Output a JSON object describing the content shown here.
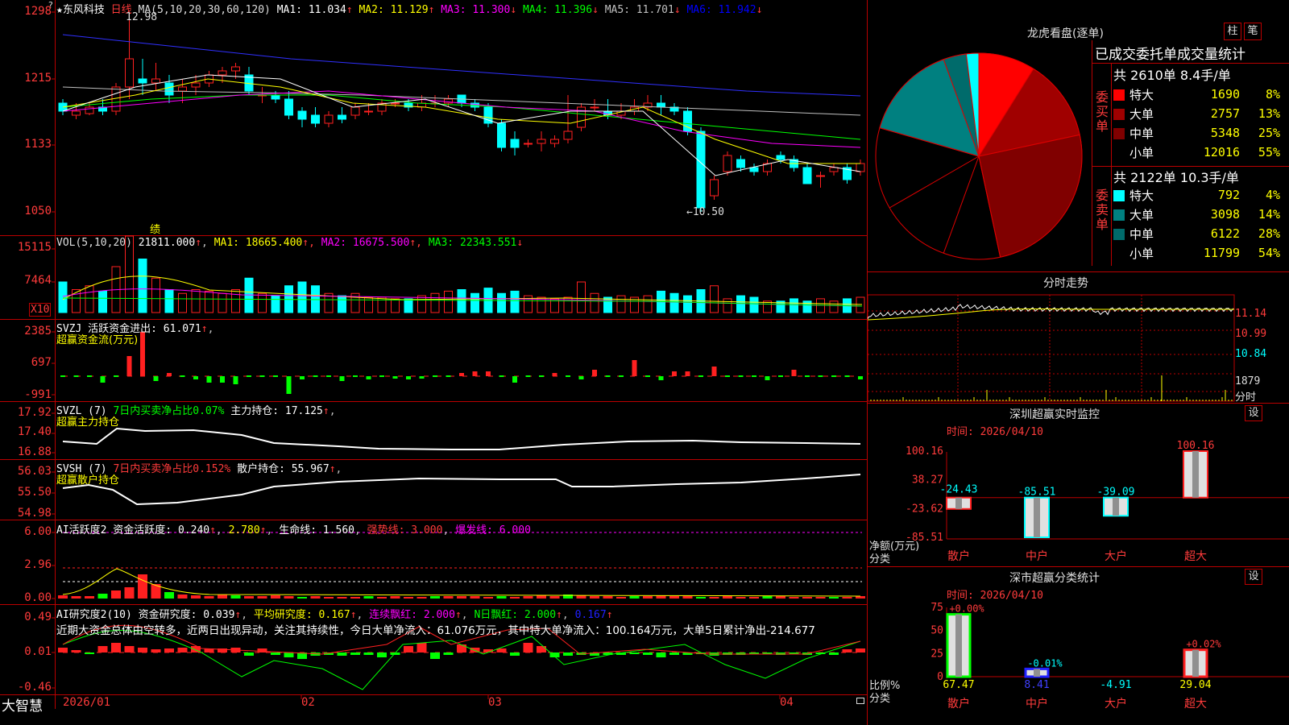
{
  "stock": {
    "name": "东风科技",
    "period": "日线",
    "star": "★"
  },
  "top_left_marker": "?",
  "kline": {
    "ma_header_prefix": "MA(5,10,20,30,60,120)",
    "ma_items": [
      {
        "label": "MA1: 11.034",
        "arrow": "↑",
        "color": "#ffffff"
      },
      {
        "label": "MA2: 11.129",
        "arrow": "↑",
        "color": "#ffff00"
      },
      {
        "label": "MA3: 11.300",
        "arrow": "↓",
        "color": "#ff00ff"
      },
      {
        "label": "MA4: 11.396",
        "arrow": "↓",
        "color": "#00ff00"
      },
      {
        "label": "MA5: 11.701",
        "arrow": "↓",
        "color": "#c0c0c0"
      },
      {
        "label": "MA6: 11.942",
        "arrow": "↓",
        "color": "#0000ff"
      }
    ],
    "y_labels": [
      "1298",
      "1215",
      "1133",
      "1050"
    ],
    "high_annot": "12.98",
    "low_annot": "←10.50",
    "marker": "绩"
  },
  "vol": {
    "header": "VOL(5,10,20)",
    "value": "21811.000",
    "items": [
      {
        "label": "MA1: 18665.400",
        "arrow": "↑",
        "color": "#ffff00"
      },
      {
        "label": "MA2: 16675.500",
        "arrow": "↑",
        "color": "#ff00ff"
      },
      {
        "label": "MA3: 22343.551",
        "arrow": "↓",
        "color": "#00ff00"
      }
    ],
    "y_labels": [
      "15115",
      "7464"
    ],
    "unit": "X10"
  },
  "svzj": {
    "header": "SVZJ  活跃资金进出: 61.071",
    "sub": "超赢资金流(万元)",
    "y_labels": [
      "2385",
      "697",
      "-991"
    ]
  },
  "svzl": {
    "header": "SVZL (7)",
    "ratio": "7日内买卖净占比0.07%",
    "pos": "主力持仓: 17.125",
    "sub": "超赢主力持仓",
    "y_labels": [
      "17.92",
      "17.40",
      "16.88"
    ]
  },
  "svsh": {
    "header": "SVSH (7)",
    "ratio": "7日内买卖净占比0.152%",
    "pos": "散户持仓: 55.967",
    "sub": "超赢散户持仓",
    "y_labels": [
      "56.03",
      "55.50",
      "54.98"
    ]
  },
  "ai1": {
    "header": "AI活跃度2 资金活跃度: 0.240",
    "v2": "2.780",
    "life": "生命线: 1.560",
    "strong": "强势线: 3.000",
    "burst": "爆发线: 6.000",
    "y_labels": [
      "6.00",
      "2.96",
      "0.00"
    ]
  },
  "ai2": {
    "header": "AI研究度2(10) 资金研究度: 0.039",
    "avg": "平均研究度: 0.167",
    "red": "连续飘红: 2.000",
    "n_red": "N日飘红: 2.000",
    "last": "0.167",
    "comment": "近期大资金总体由空转多，近两日出现异动，关注其持续性，今日大单净流入：61.076万元，其中特大单净流入：100.164万元，大单5日累计净出-214.677",
    "y_labels": [
      "0.49",
      "0.01",
      "-0.46"
    ]
  },
  "xaxis": {
    "labels": [
      "2026/01",
      "02",
      "03",
      "04"
    ],
    "brand": "大智慧"
  },
  "dragon": {
    "title": "龙虎看盘(逐单)",
    "btn1": "柱",
    "btn2": "笔",
    "stat_title": "已成交委托单成交量统计",
    "buy_label": "委买单",
    "sell_label": "委卖单",
    "buy_total": "共 2610单 8.4手/单",
    "sell_total": "共 2122单 10.3手/单",
    "buy_rows": [
      {
        "name": "特大",
        "count": "1690",
        "pct": "8%",
        "color": "#ff0000"
      },
      {
        "name": "大单",
        "count": "2757",
        "pct": "13%",
        "color": "#a00000"
      },
      {
        "name": "中单",
        "count": "5348",
        "pct": "25%",
        "color": "#800000"
      },
      {
        "name": "小单",
        "count": "12016",
        "pct": "55%",
        "color": "#000000"
      }
    ],
    "sell_rows": [
      {
        "name": "特大",
        "count": "792",
        "pct": "4%",
        "color": "#00ffff"
      },
      {
        "name": "大单",
        "count": "3098",
        "pct": "14%",
        "color": "#008080"
      },
      {
        "name": "中单",
        "count": "6122",
        "pct": "28%",
        "color": "#006b6b"
      },
      {
        "name": "小单",
        "count": "11799",
        "pct": "54%",
        "color": "#000000"
      }
    ]
  },
  "intraday": {
    "title": "分时走势",
    "y_labels": [
      "11.14",
      "10.99",
      "10.84"
    ],
    "vol_label": "1879",
    "vol_unit": "分时"
  },
  "monitor": {
    "title": "深圳超赢实时监控",
    "set": "设",
    "time": "时间: 2026/04/10",
    "y_labels": [
      "100.16",
      "38.27",
      "-23.62",
      "-85.51"
    ],
    "axis_unit": "净额(万元)",
    "axis_cat": "分类",
    "categories": [
      "散户",
      "中户",
      "大户",
      "超大"
    ],
    "values": [
      -24.43,
      -85.51,
      -39.09,
      100.16
    ],
    "value_labels": [
      "-24.43",
      "-85.51",
      "-39.09",
      "100.16"
    ]
  },
  "classify": {
    "title": "深市超赢分类统计",
    "set": "设",
    "time": "时间: 2026/04/10",
    "y_labels": [
      "75",
      "50",
      "25",
      "0"
    ],
    "axis_unit": "比例%",
    "axis_cat": "分类",
    "categories": [
      "散户",
      "中户",
      "大户",
      "超大"
    ],
    "values": [
      67.47,
      8.41,
      -4.91,
      29.04
    ],
    "value_labels": [
      "67.47",
      "8.41",
      "-4.91",
      "29.04"
    ],
    "change_labels": [
      "+0.00%",
      "-0.01%",
      "",
      "+0.02%"
    ]
  }
}
